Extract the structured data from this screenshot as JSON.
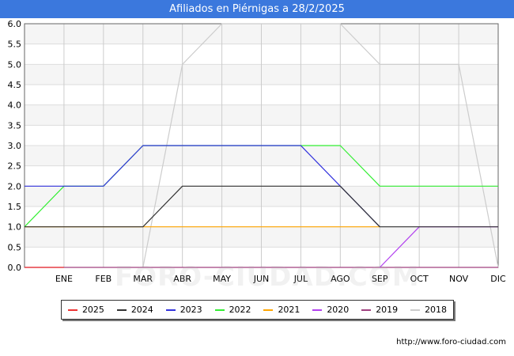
{
  "title": "Afiliados en Piérnigas a 28/2/2025",
  "source": "http://www.foro-ciudad.com",
  "watermark": "FORO-CIUDAD.COM",
  "chart_data": {
    "type": "line",
    "title": "Afiliados en Piérnigas a 28/2/2025",
    "categories": [
      "",
      "ENE",
      "FEB",
      "MAR",
      "ABR",
      "MAY",
      "JUN",
      "JUL",
      "AGO",
      "SEP",
      "OCT",
      "NOV",
      "DIC"
    ],
    "ylim": [
      0,
      6
    ],
    "yticks": [
      "0.0",
      "0.5",
      "1.0",
      "1.5",
      "2.0",
      "2.5",
      "3.0",
      "3.5",
      "4.0",
      "4.5",
      "5.0",
      "5.5",
      "6.0"
    ],
    "grid": true,
    "legend_position": "bottom",
    "series": [
      {
        "name": "2018",
        "color": "#cccccc",
        "values": [
          null,
          null,
          null,
          0,
          5,
          6,
          6,
          6,
          6,
          5,
          5,
          5,
          0
        ]
      },
      {
        "name": "2019",
        "color": "#a0407f",
        "values": [
          0,
          0,
          0,
          0,
          0,
          0,
          0,
          0,
          0,
          0,
          0,
          0,
          0
        ]
      },
      {
        "name": "2020",
        "color": "#b240ef",
        "values": [
          null,
          null,
          null,
          null,
          null,
          null,
          null,
          null,
          null,
          0,
          1,
          1,
          1
        ]
      },
      {
        "name": "2021",
        "color": "#ffa500",
        "values": [
          1,
          1,
          1,
          1,
          1,
          1,
          1,
          1,
          1,
          1,
          null,
          null,
          null
        ]
      },
      {
        "name": "2022",
        "color": "#33ee33",
        "values": [
          1,
          2,
          2,
          3,
          3,
          3,
          3,
          3,
          3,
          2,
          2,
          2,
          2
        ]
      },
      {
        "name": "2023",
        "color": "#3333dd",
        "values": [
          2,
          2,
          2,
          3,
          3,
          3,
          3,
          3,
          2,
          1,
          null,
          null,
          null
        ]
      },
      {
        "name": "2024",
        "color": "#333333",
        "values": [
          1,
          1,
          1,
          1,
          2,
          2,
          2,
          2,
          2,
          1,
          1,
          1,
          1
        ]
      },
      {
        "name": "2025",
        "color": "#ee3333",
        "values": [
          0,
          0,
          null,
          null,
          null,
          null,
          null,
          null,
          null,
          null,
          null,
          null,
          null
        ]
      }
    ],
    "legend_order": [
      "2025",
      "2024",
      "2023",
      "2022",
      "2021",
      "2020",
      "2019",
      "2018"
    ]
  }
}
